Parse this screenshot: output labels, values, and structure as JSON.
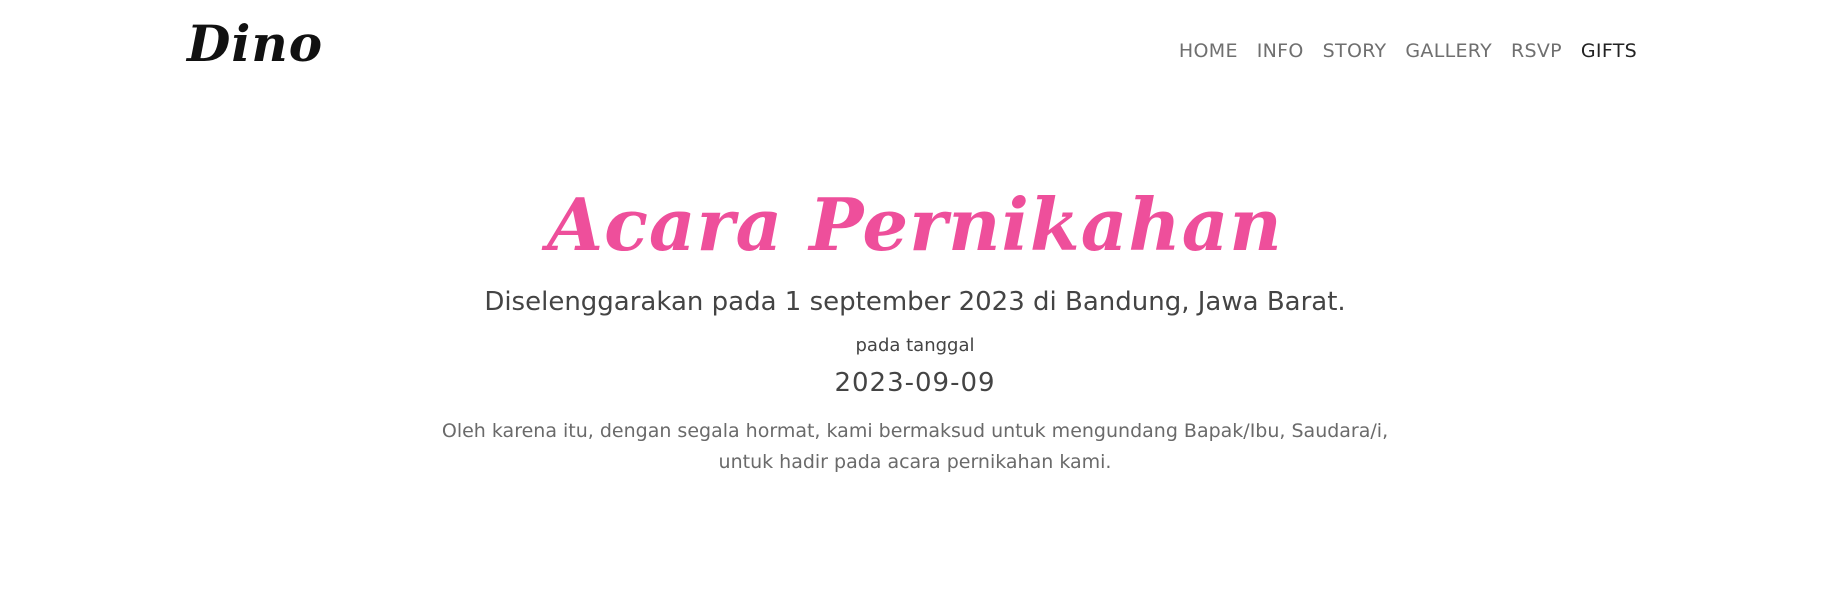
{
  "brand": {
    "name": "Dino"
  },
  "nav": {
    "items": [
      {
        "label": "HOME"
      },
      {
        "label": "INFO"
      },
      {
        "label": "STORY"
      },
      {
        "label": "GALLERY"
      },
      {
        "label": "RSVP"
      },
      {
        "label": "GIFTS"
      }
    ],
    "active_item": "GIFTS"
  },
  "hero": {
    "title": "Acara Pernikahan",
    "subtitle": "Diselenggarakan pada 1 september 2023 di Bandung, Jawa Barat.",
    "date_label": "pada tanggal",
    "date_value": "2023-09-09",
    "invitation_line1": "Oleh karena itu, dengan segala hormat, kami bermaksud untuk mengundang Bapak/Ibu, Saudara/i,",
    "invitation_line2": "untuk hadir pada acara pernikahan kami."
  },
  "colors": {
    "accent": "#ee4f9b",
    "text": "#444444",
    "muted": "#6a6a6a",
    "nav_text": "#6f6f6f"
  }
}
